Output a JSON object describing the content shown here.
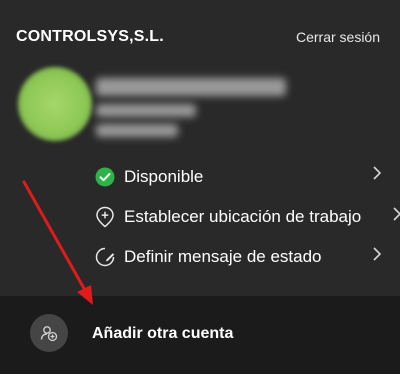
{
  "header": {
    "org_name": "CONTROLSYS,S.L.",
    "sign_out_label": "Cerrar sesión"
  },
  "menu": {
    "items": [
      {
        "label": "Disponible",
        "icon": "available-check-icon",
        "icon_color": "#2eb34a"
      },
      {
        "label": "Establecer ubicación de trabajo",
        "icon": "location-pin-icon"
      },
      {
        "label": "Definir mensaje de estado",
        "icon": "status-message-icon"
      }
    ]
  },
  "footer": {
    "add_account_label": "Añadir otra cuenta",
    "icon": "add-account-icon"
  },
  "colors": {
    "panel_bg": "#292929",
    "footer_bg": "#1b1b1b",
    "annotation_arrow": "#e01b1b",
    "avatar": "#8ec955"
  }
}
